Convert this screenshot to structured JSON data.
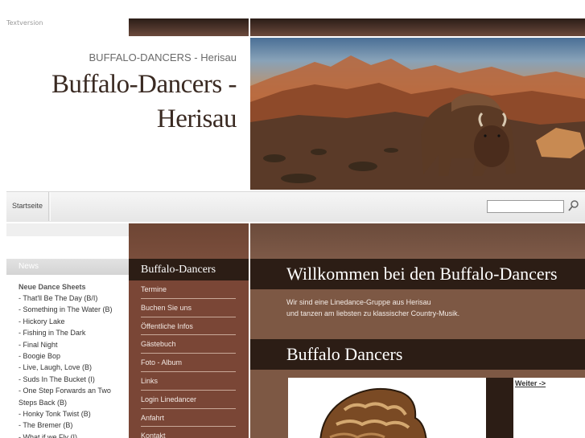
{
  "header": {
    "textversion_link": "Textversion",
    "subtitle": "BUFFALO-DANCERS - Herisau",
    "title": "Buffalo-Dancers - Herisau"
  },
  "nav": {
    "home_label": "Startseite",
    "search_value": ""
  },
  "news": {
    "header": "News",
    "heading": "Neue Dance Sheets",
    "items": [
      "- That'll Be The Day (B/I)",
      "- Something in The Water (B)",
      "- Hickory Lake",
      "- Fishing in The Dark",
      "- Final Night",
      "- Boogie Bop",
      "- Live, Laugh, Love (B)",
      "- Suds In The Bucket (I)",
      "- One Step Forwards an Two",
      "Steps Back (B)",
      "- Honky Tonk Twist (B)",
      "- The Bremer (B)",
      "- What if we Fly (I)"
    ]
  },
  "menu": {
    "title": "Buffalo-Dancers",
    "items": [
      "Termine",
      "Buchen Sie uns",
      "Öffentliche Infos",
      "Gästebuch",
      "Foto - Album",
      "Links",
      "Login Linedancer",
      "Anfahrt",
      "Kontakt"
    ]
  },
  "main": {
    "welcome_title": "Willkommen bei den Buffalo-Dancers",
    "welcome_line1": "Wir sind eine Linedance-Gruppe aus Herisau",
    "welcome_line2": "und tanzen am liebsten zu klassischer Country-Musik.",
    "section_title": "Buffalo Dancers",
    "weiter_link": "Weiter ->"
  },
  "colors": {
    "dark_brown": "#2c1d15",
    "menu_brown": "#7a4636",
    "content_brown": "#7d5844"
  }
}
